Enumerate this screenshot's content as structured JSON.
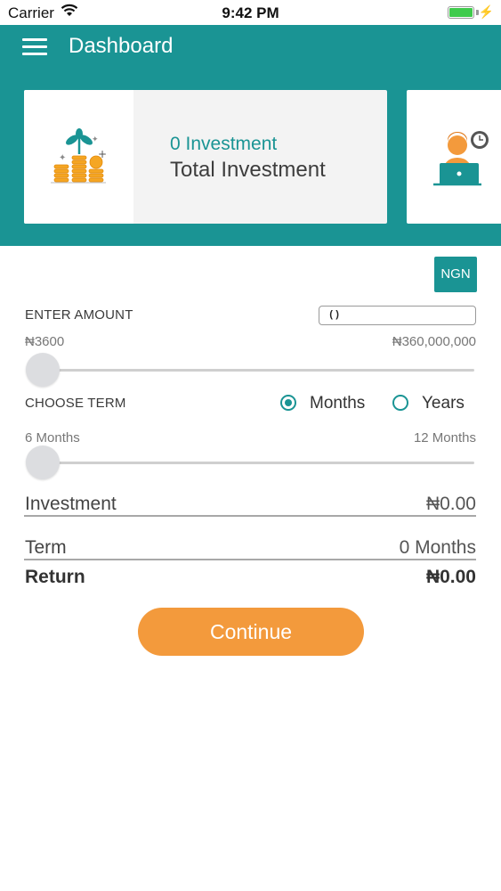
{
  "status_bar": {
    "carrier": "Carrier",
    "time": "9:42 PM",
    "battery_level": 1.0
  },
  "header": {
    "title": "Dashboard",
    "menu_icon": "hamburger-menu-icon"
  },
  "cards": [
    {
      "amount": "0 Investment",
      "label": "Total Investment",
      "icon": "money-plant-coins-icon"
    },
    {
      "icon": "person-at-laptop-clock-icon"
    }
  ],
  "currency_button": "NGN",
  "amount_section": {
    "label": "ENTER AMOUNT",
    "input_value": "()",
    "min_label": "₦3600",
    "max_label": "₦360,000,000",
    "slider_fraction": 0.0
  },
  "term_section": {
    "label": "CHOOSE TERM",
    "options": [
      {
        "label": "Months",
        "selected": true
      },
      {
        "label": "Years",
        "selected": false
      }
    ],
    "min_label": "6 Months",
    "max_label": "12 Months",
    "slider_fraction": 0.0
  },
  "summary": {
    "investment_label": "Investment",
    "investment_value": "₦0.00",
    "term_label": "Term",
    "term_value": "0 Months",
    "return_label": "Return",
    "return_value": "₦0.00"
  },
  "continue_button": "Continue",
  "colors": {
    "teal": "#1a9494",
    "orange": "#f39a3c"
  }
}
